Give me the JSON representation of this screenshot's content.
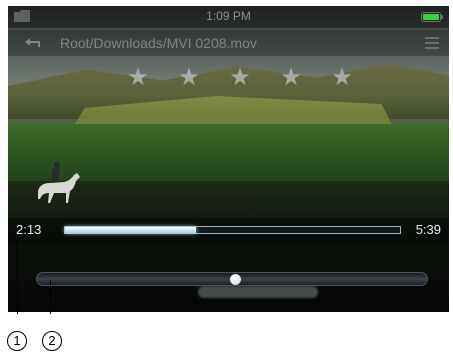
{
  "status_bar": {
    "time": "1:09 PM",
    "folder_icon": "folder-icon",
    "battery_icon": "battery-icon",
    "battery_color": "#3ecf3e"
  },
  "title_bar": {
    "back_icon": "back-arrow-icon",
    "path": "Root/Downloads/MVI 0208.mov",
    "menu_icon": "menu-icon"
  },
  "rating": {
    "stars_total": 5,
    "star_glyph": "★"
  },
  "playback": {
    "elapsed": "2:13",
    "total": "5:39",
    "progress_fraction": 0.392
  },
  "volume": {
    "level_fraction": 0.51
  },
  "callouts": {
    "one": "1",
    "two": "2"
  }
}
